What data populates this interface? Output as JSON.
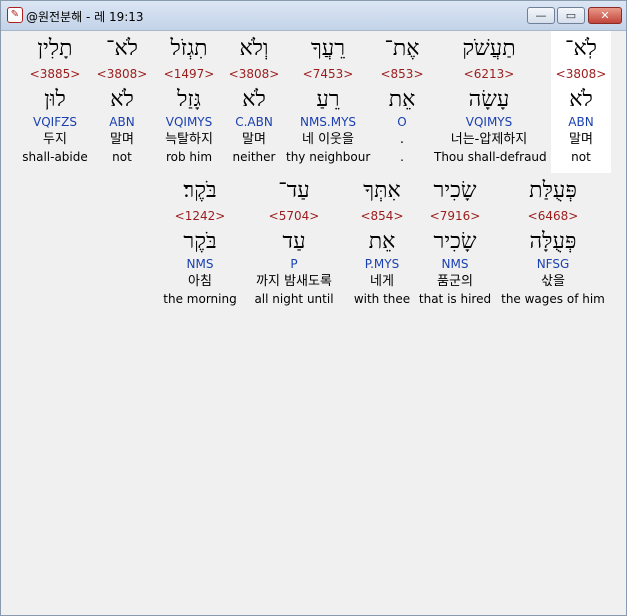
{
  "window": {
    "title": "@원전분해 - 레 19:13",
    "app_icon": "app-logo-icon",
    "controls": {
      "minimize": "—",
      "maximize": "▭",
      "close": "✕"
    }
  },
  "row1": [
    {
      "heb": "לֹֽא־",
      "strong": "<3808>",
      "lemma": "לֹא",
      "morph": "ABN",
      "kor": "말며",
      "eng": "not"
    },
    {
      "heb": "תַעֲשֹׁק",
      "strong": "<6213>",
      "lemma": "עָשָׂה",
      "morph": "VQIMYS",
      "kor": "너는-압제하지",
      "eng": "Thou shall-defraud"
    },
    {
      "heb": "אֶת־",
      "strong": "<853>",
      "lemma": "אֵת",
      "morph": "O",
      "kor": ".",
      "eng": "."
    },
    {
      "heb": "רֵעֲךָ",
      "strong": "<7453>",
      "lemma": "רֵעַ",
      "morph": "NMS.MYS",
      "kor": "네 이웃을",
      "eng": "thy neighbour"
    },
    {
      "heb": "וְלֹא",
      "strong": "<3808>",
      "lemma": "לֹא",
      "morph": "C.ABN",
      "kor": "말며",
      "eng": "neither"
    },
    {
      "heb": "תִגְזֹל",
      "strong": "<1497>",
      "lemma": "גָּזַל",
      "morph": "VQIMYS",
      "kor": "늑탈하지",
      "eng": "rob him"
    },
    {
      "heb": "לֹא־",
      "strong": "<3808>",
      "lemma": "לֹא",
      "morph": "ABN",
      "kor": "말며",
      "eng": "not"
    },
    {
      "heb": "תָלִין",
      "strong": "<3885>",
      "lemma": "לוּן",
      "morph": "VQIFZS",
      "kor": "두지",
      "eng": "shall-abide"
    }
  ],
  "row2": [
    {
      "heb": "פְּעֻלַּת",
      "strong": "<6468>",
      "lemma": "פְּעֻלָּה",
      "morph": "NFSG",
      "kor": "삯을",
      "eng": "the wages of him"
    },
    {
      "heb": "שָׂכִיר",
      "strong": "<7916>",
      "lemma": "שָׂכִיר",
      "morph": "NMS",
      "kor": "품군의",
      "eng": "that is hired"
    },
    {
      "heb": "אִתְּךָ",
      "strong": "<854>",
      "lemma": "אֵת",
      "morph": "P.MYS",
      "kor": "네게",
      "eng": "with thee"
    },
    {
      "heb": "עַד־",
      "strong": "<5704>",
      "lemma": "עַד",
      "morph": "P",
      "kor": "까지 밤새도록",
      "eng": "all night until"
    },
    {
      "heb": "בֹּקֶר׃",
      "strong": "<1242>",
      "lemma": "בֹּקֶר",
      "morph": "NMS",
      "kor": "아침",
      "eng": "the morning"
    }
  ],
  "colors": {
    "strong": "#9b1c1c",
    "morph": "#1a3fb0",
    "selected_bg": "#ffffff",
    "window_bg": "#f0f0f0"
  }
}
